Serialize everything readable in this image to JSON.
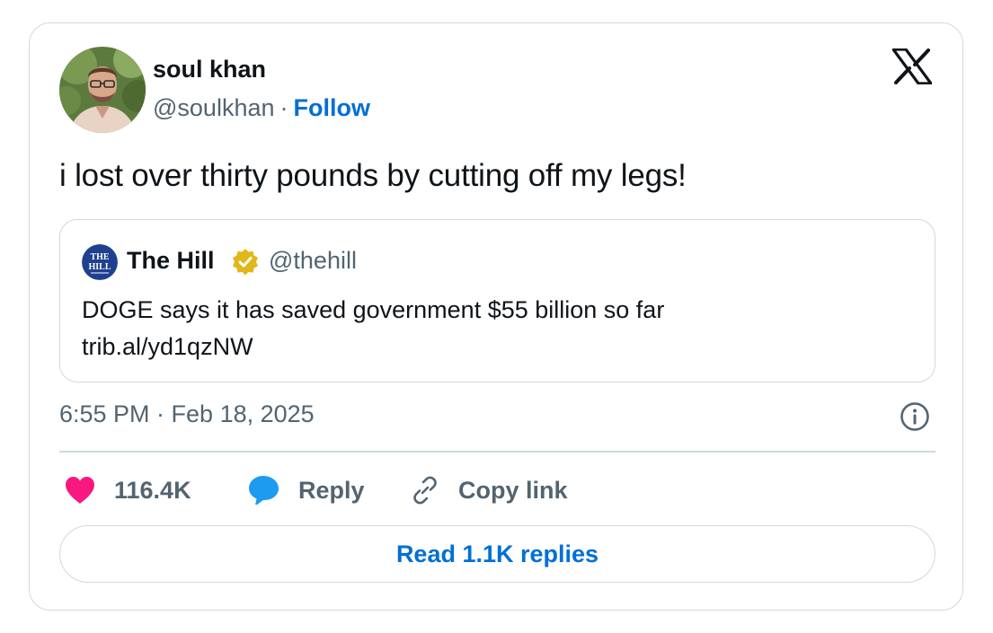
{
  "author": {
    "display_name": "soul khan",
    "handle": "@soulkhan",
    "separator": "·",
    "follow_label": "Follow"
  },
  "tweet": {
    "text": "i lost over thirty pounds by cutting off my legs!",
    "timestamp": "6:55 PM · Feb 18, 2025"
  },
  "quoted": {
    "name": "The Hill",
    "handle": "@thehill",
    "text_line1": "DOGE says it has saved government $55 billion so far",
    "text_line2": "trib.al/yd1qzNW",
    "avatar_logo_text_line1": "THE",
    "avatar_logo_text_line2": "HILL"
  },
  "actions": {
    "like_count": "116.4K",
    "reply_label": "Reply",
    "copy_label": "Copy link",
    "read_replies_label": "Read 1.1K replies"
  },
  "icons": {
    "brand": "x-logo-icon",
    "like": "heart-icon",
    "reply": "speech-bubble-icon",
    "copy": "link-icon",
    "info": "info-icon",
    "verified": "verified-badge-icon"
  },
  "colors": {
    "link_blue": "#006fd6",
    "heart_pink": "#f91880",
    "reply_blue": "#1d9bf0",
    "muted_text": "#536471",
    "border": "#cfd9de",
    "gold_badge": "#e2b719"
  }
}
